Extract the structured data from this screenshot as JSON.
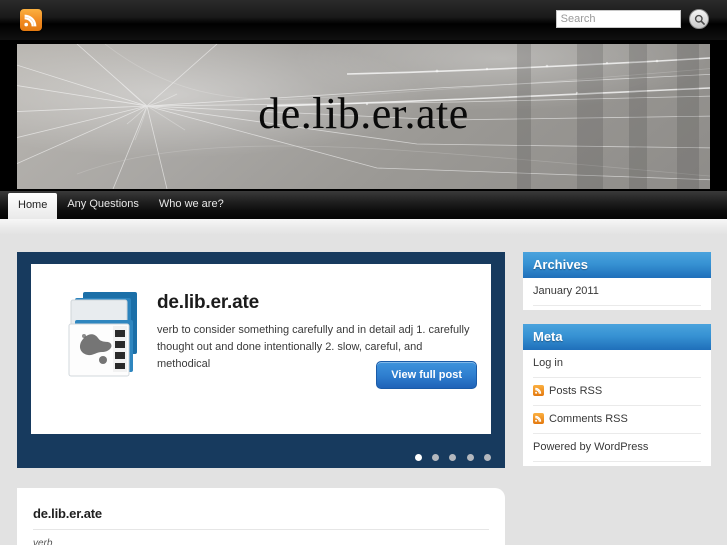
{
  "topbar": {
    "rss_icon": "rss-icon",
    "search": {
      "placeholder": "Search",
      "value": "",
      "button_icon": "search-icon"
    }
  },
  "header": {
    "site_title": "de.lib.er.ate",
    "banner_image": "spider-web-photo"
  },
  "nav": {
    "items": [
      {
        "label": "Home",
        "active": true
      },
      {
        "label": "Any Questions",
        "active": false
      },
      {
        "label": "Who we are?",
        "active": false
      }
    ]
  },
  "slider": {
    "thumbnail_icon": "stacked-documents-icon",
    "title": "de.lib.er.ate",
    "excerpt": "verb to consider something carefully and in detail adj 1.  carefully thought out and done intentionally 2.  slow, careful, and methodical",
    "button_label": "View full post",
    "dots": 5,
    "active_dot": 0,
    "background_color": "#173a5e",
    "button_color": "#2f7fd0"
  },
  "sidebar": {
    "widgets": [
      {
        "title": "Archives",
        "items": [
          {
            "label": "January 2011",
            "icon": null
          }
        ]
      },
      {
        "title": "Meta",
        "items": [
          {
            "label": "Log in",
            "icon": null
          },
          {
            "label": "Posts RSS",
            "icon": "rss-icon"
          },
          {
            "label": "Comments RSS",
            "icon": "rss-icon"
          },
          {
            "label": "Powered by WordPress",
            "icon": null
          }
        ]
      }
    ],
    "header_color": "#3792d3"
  },
  "post": {
    "title": "de.lib.er.ate",
    "body": "verb"
  }
}
